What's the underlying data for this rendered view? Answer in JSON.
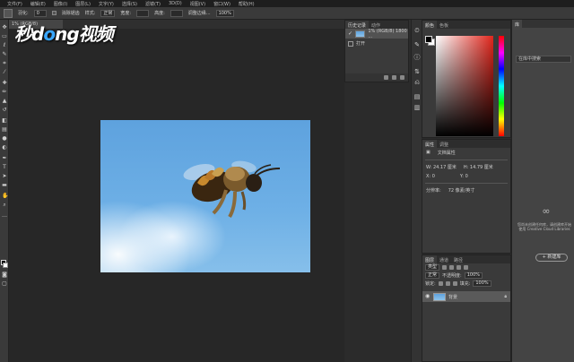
{
  "menu": [
    "文件(F)",
    "编辑(E)",
    "图像(I)",
    "图层(L)",
    "文字(Y)",
    "选择(S)",
    "滤镜(T)",
    "3D(D)",
    "视图(V)",
    "窗口(W)",
    "帮助(H)"
  ],
  "options": {
    "feather_label": "羽化:",
    "feather_value": "0",
    "anti_alias_label": "消除锯齿",
    "style_label": "样式:",
    "style_value": "正常",
    "width_label": "宽度:",
    "height_label": "高度:",
    "refine_label": "调整边缘...",
    "zoom_value": "100%"
  },
  "document_tab": "1% (RGB/8)",
  "watermark": {
    "part1": "秒",
    "part2": "d",
    "part3": "o",
    "part4": "ng视频"
  },
  "history": {
    "tabs": [
      "历史记录",
      "动作"
    ],
    "rows": [
      {
        "label": "1% (RGB/8) 1800 ..."
      },
      {
        "label": "打开"
      }
    ]
  },
  "color": {
    "tabs": [
      "颜色",
      "色板"
    ]
  },
  "properties": {
    "tabs": [
      "属性",
      "调整"
    ],
    "doc_label": "文档属性",
    "w_label": "W:",
    "w_value": "24.17 厘米",
    "h_label": "H:",
    "h_value": "14.79 厘米",
    "x_label": "X:",
    "x_value": "0",
    "y_label": "Y:",
    "y_value": "0",
    "res_label": "分辨率:",
    "res_value": "72 像素/英寸"
  },
  "layers": {
    "tabs": [
      "图层",
      "通道",
      "路径"
    ],
    "kind_label": "类型",
    "blend_value": "正常",
    "opacity_label": "不透明度:",
    "opacity_value": "100%",
    "lock_label": "锁定:",
    "fill_label": "填充:",
    "fill_value": "100%",
    "layer_name": "背景"
  },
  "libraries": {
    "tab": "库",
    "search_placeholder": "在库中搜索",
    "description": "您尚未创建任何库，请创建库开始使用 Creative Cloud Libraries",
    "create_label": "+ 新建库"
  },
  "colors": {
    "sky": "#5ea2de",
    "accent": "#39a7ff",
    "panel": "#3a3a3a"
  }
}
